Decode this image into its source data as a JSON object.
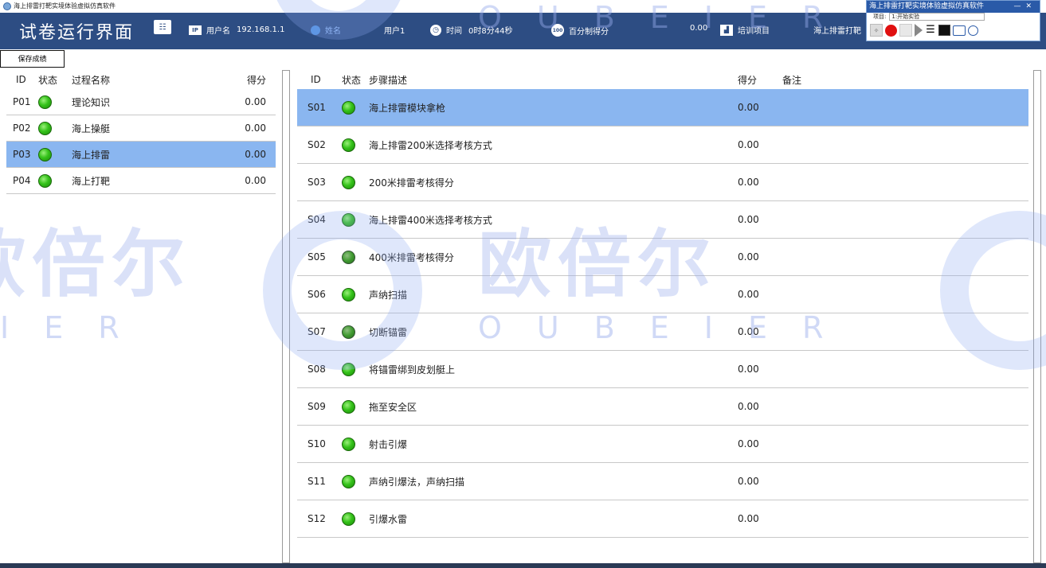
{
  "window": {
    "title": "海上排雷打靶实境体验虚拟仿真软件"
  },
  "header": {
    "title": "试卷运行界面",
    "username_label": "用户名",
    "username_value": "192.168.1.1",
    "name_label": "姓名",
    "name_value": "用户1",
    "time_label": "时间",
    "time_value": "0时8分44秒",
    "score_label": "百分制得分",
    "score_value": "0.00",
    "project_label": "培训项目",
    "project_value": "海上排雷打靶"
  },
  "control_panel": {
    "title": "海上排雷打靶实境体验虚拟仿真软件",
    "window_buttons": "—✕",
    "project_label": "项目:",
    "project_value": "1:开始实验"
  },
  "toolbar": {
    "save_label": "保存成绩"
  },
  "left_table": {
    "headers": {
      "id": "ID",
      "status": "状态",
      "name": "过程名称",
      "score": "得分"
    },
    "rows": [
      {
        "id": "P01",
        "name": "理论知识",
        "score": "0.00"
      },
      {
        "id": "P02",
        "name": "海上操艇",
        "score": "0.00"
      },
      {
        "id": "P03",
        "name": "海上排雷",
        "score": "0.00"
      },
      {
        "id": "P04",
        "name": "海上打靶",
        "score": "0.00"
      }
    ]
  },
  "right_table": {
    "headers": {
      "id": "ID",
      "status": "状态",
      "desc": "步骤描述",
      "score": "得分",
      "note": "备注"
    },
    "rows": [
      {
        "id": "S01",
        "desc": "海上排雷模块拿枪",
        "score": "0.00"
      },
      {
        "id": "S02",
        "desc": "海上排雷200米选择考核方式",
        "score": "0.00"
      },
      {
        "id": "S03",
        "desc": "200米排雷考核得分",
        "score": "0.00"
      },
      {
        "id": "S04",
        "desc": "海上排雷400米选择考核方式",
        "score": "0.00"
      },
      {
        "id": "S05",
        "desc": "400米排雷考核得分",
        "score": "0.00"
      },
      {
        "id": "S06",
        "desc": "声纳扫描",
        "score": "0.00"
      },
      {
        "id": "S07",
        "desc": "切断锚雷",
        "score": "0.00"
      },
      {
        "id": "S08",
        "desc": "将锚雷绑到皮划艇上",
        "score": "0.00"
      },
      {
        "id": "S09",
        "desc": "拖至安全区",
        "score": "0.00"
      },
      {
        "id": "S10",
        "desc": "射击引爆",
        "score": "0.00"
      },
      {
        "id": "S11",
        "desc": "声纳引爆法，声纳扫描",
        "score": "0.00"
      },
      {
        "id": "S12",
        "desc": "引爆水雷",
        "score": "0.00"
      }
    ]
  },
  "watermark": {
    "text": "欧倍尔",
    "sub": "OUBEIER",
    "sub_partial": "IER"
  },
  "icons": {
    "table_icon": "table-icon",
    "ip_icon": "ip-icon",
    "user_icon": "user-icon",
    "clock_icon": "clock-icon",
    "score100_icon": "score-100-icon",
    "chart_icon": "chart-icon"
  },
  "colors": {
    "header_bg": "#2d4d83",
    "selected_row": "#8ab6f0",
    "status_green": "#35c21a"
  }
}
